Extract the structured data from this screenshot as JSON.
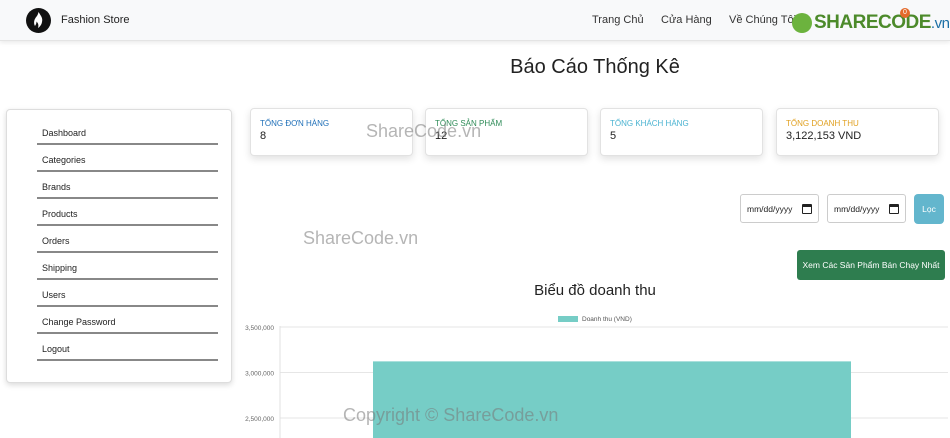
{
  "navbar": {
    "brand": "Fashion Store",
    "links": [
      "Trang Chủ",
      "Cửa Hàng",
      "Về Chúng Tôi"
    ],
    "watermark_brand_main": "SHARECODE",
    "watermark_brand_tld": ".vn",
    "watermark_badge": "0"
  },
  "page": {
    "title": "Báo Cáo Thống Kê"
  },
  "sidebar": {
    "items": [
      "Dashboard",
      "Categories",
      "Brands",
      "Products",
      "Orders",
      "Shipping",
      "Users",
      "Change Password",
      "Logout"
    ]
  },
  "stats": [
    {
      "label": "TỔNG ĐƠN HÀNG",
      "value": "8",
      "color": "#1e6fb8"
    },
    {
      "label": "TỔNG SẢN PHẨM",
      "value": "12",
      "color": "#2e8b57"
    },
    {
      "label": "TỔNG KHÁCH HÀNG",
      "value": "5",
      "color": "#4ab3d1"
    },
    {
      "label": "TỔNG DOANH THU",
      "value": "3,122,153 VND",
      "color": "#e0a020"
    }
  ],
  "filter": {
    "start_placeholder": "mm/dd/yyyy",
    "end_placeholder": "mm/dd/yyyy",
    "button": "Lọc",
    "best_sellers_button": "Xem Các Sản Phẩm Bán Chạy Nhất"
  },
  "chart_data": {
    "type": "bar",
    "title": "Biểu đồ doanh thu",
    "legend": "top",
    "series": [
      {
        "name": "Doanh thu (VND)",
        "values": [
          3122153
        ],
        "color": "#76cdc6"
      }
    ],
    "categories": [
      ""
    ],
    "ylim": [
      2300000,
      3500000
    ],
    "yticks": [
      "3,500,000",
      "3,000,000",
      "2,500,000"
    ],
    "grid": true
  },
  "watermarks": [
    "ShareCode.vn",
    "ShareCode.vn",
    "Copyright © ShareCode.vn"
  ]
}
